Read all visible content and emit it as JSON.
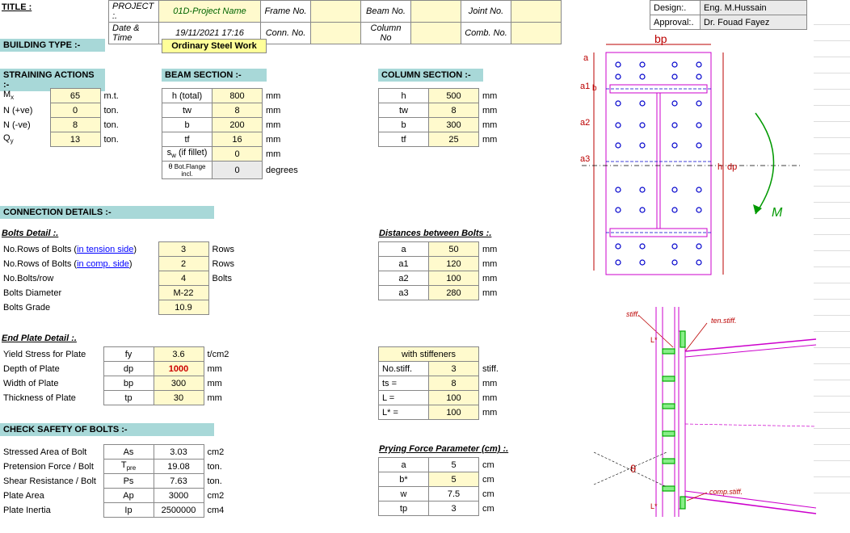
{
  "header": {
    "title_label": "TITLE :",
    "project_label": "PROJECT :.",
    "project_value": "01D-Project Name",
    "datetime_label": "Date & Time",
    "datetime_value": "19/11/2021 17:16",
    "frame_no_label": "Frame No.",
    "conn_no_label": "Conn. No.",
    "beam_no_label": "Beam No.",
    "column_no_label": "Column No",
    "joint_no_label": "Joint No.",
    "comb_no_label": "Comb. No.",
    "design_label": "Design:.",
    "design_value": "Eng. M.Hussain",
    "approval_label": "Approval:.",
    "approval_value": "Dr. Fouad Fayez"
  },
  "building_type": {
    "label": "BUILDING TYPE :-",
    "value": "Ordinary Steel Work"
  },
  "straining": {
    "label": "STRAINING ACTIONS :-",
    "mx_label": "M",
    "mx_sub": "x",
    "mx_val": "65",
    "mx_unit": "m.t.",
    "npos_label": "N  (+ve)",
    "npos_val": "0",
    "npos_unit": "ton.",
    "nneg_label": "N  (-ve)",
    "nneg_val": "8",
    "nneg_unit": "ton.",
    "qy_label": "Q",
    "qy_sub": "y",
    "qy_val": "13",
    "qy_unit": "ton."
  },
  "beam_section": {
    "label": "BEAM SECTION :-",
    "h_label": "h  (total)",
    "h_val": "800",
    "u": "mm",
    "tw_label": "tw",
    "tw_val": "8",
    "b_label": "b",
    "b_val": "200",
    "tf_label": "tf",
    "tf_val": "16",
    "sw_label_pre": "s",
    "sw_sub": "w",
    "sw_label_post": " (if fillet)",
    "sw_val": "0",
    "theta_label_pre": "θ",
    "theta_label_post": " Bot.Flange incl.",
    "theta_val": "0",
    "theta_unit": "degrees"
  },
  "column_section": {
    "label": "COLUMN SECTION :-",
    "h_label": "h",
    "h_val": "500",
    "tw_label": "tw",
    "tw_val": "8",
    "b_label": "b",
    "b_val": "300",
    "tf_label": "tf",
    "tf_val": "25"
  },
  "conn_details": {
    "label": "CONNECTION DETAILS :-"
  },
  "bolts_detail": {
    "heading": "Bolts Detail :.",
    "rows_tension_pre": "No.Rows of Bolts  (",
    "rows_tension_link": "in tension side",
    "rows_tension_post": ")",
    "rows_tension_val": "3",
    "rows_tension_unit": "Rows",
    "rows_comp_pre": "No.Rows of Bolts  (",
    "rows_comp_link": "in comp. side",
    "rows_comp_post": ")",
    "rows_comp_val": "2",
    "rows_comp_unit": "Rows",
    "bolts_row_label": "No.Bolts/row",
    "bolts_row_val": "4",
    "bolts_row_unit": "Bolts",
    "diameter_label": "Bolts Diameter",
    "diameter_val": "M-22",
    "grade_label": "Bolts Grade",
    "grade_val": "10.9"
  },
  "distances": {
    "heading": "Distances between Bolts :.",
    "a_label": "a",
    "a_val": "50",
    "a1_label": "a1",
    "a1_val": "120",
    "a2_label": "a2",
    "a2_val": "100",
    "a3_label": "a3",
    "a3_val": "280",
    "unit": "mm"
  },
  "end_plate": {
    "heading": "End Plate Detail :.",
    "yield_label": "Yield Stress for Plate",
    "yield_sym": "fy",
    "yield_val": "3.6",
    "yield_unit": "t/cm2",
    "depth_label": "Depth of Plate",
    "depth_sym": "dp",
    "depth_val": "1000",
    "depth_unit": "mm",
    "width_label": "Width of Plate",
    "width_sym": "bp",
    "width_val": "300",
    "width_unit": "mm",
    "thick_label": "Thickness of Plate",
    "thick_sym": "tp",
    "thick_val": "30",
    "thick_unit": "mm"
  },
  "stiffeners": {
    "heading": "with stiffeners",
    "no_label": "No.stiff.",
    "no_val": "3",
    "no_unit": "stiff.",
    "ts_label": "ts    =",
    "ts_val": "8",
    "ts_unit": "mm",
    "l_label": "L    =",
    "l_val": "100",
    "l_unit": "mm",
    "lstar_label": "L*   =",
    "lstar_val": "100",
    "lstar_unit": "mm"
  },
  "check_bolts": {
    "label": "CHECK SAFETY OF BOLTS :-",
    "stress_label": "Stressed Area of Bolt",
    "stress_sym": "As",
    "stress_val": "3.03",
    "stress_unit": "cm2",
    "preten_label": "Pretension Force / Bolt",
    "preten_sym_pre": "T",
    "preten_sym_sub": "pre",
    "preten_val": "19.08",
    "preten_unit": "ton.",
    "shear_label": "Shear Resistance / Bolt",
    "shear_sym": "Ps",
    "shear_val": "7.63",
    "shear_unit": "ton.",
    "area_label": "Plate Area",
    "area_sym": "Ap",
    "area_val": "3000",
    "area_unit": "cm2",
    "inertia_label": "Plate Inertia",
    "inertia_sym": "Ip",
    "inertia_val": "2500000",
    "inertia_unit": "cm4"
  },
  "prying": {
    "heading": "Prying Force Parameter (cm) :.",
    "a_label": "a",
    "a_val": "5",
    "a_unit": "cm",
    "bstar_label": "b*",
    "bstar_val": "5",
    "bstar_unit": "cm",
    "w_label": "w",
    "w_val": "7.5",
    "w_unit": "cm",
    "tp_label": "tp",
    "tp_val": "3",
    "tp_unit": "cm"
  },
  "drawing": {
    "bp": "bp",
    "a": "a",
    "a1": "a1",
    "a2": "a2",
    "a3": "a3",
    "h": "h",
    "dp": "dp",
    "b": "b",
    "M": "M",
    "stiff": "stiff.",
    "ten_stiff": "ten.stiff.",
    "comp_stiff": "comp.stiff.",
    "L": "L*",
    "L2": "L*",
    "theta": "θ"
  }
}
